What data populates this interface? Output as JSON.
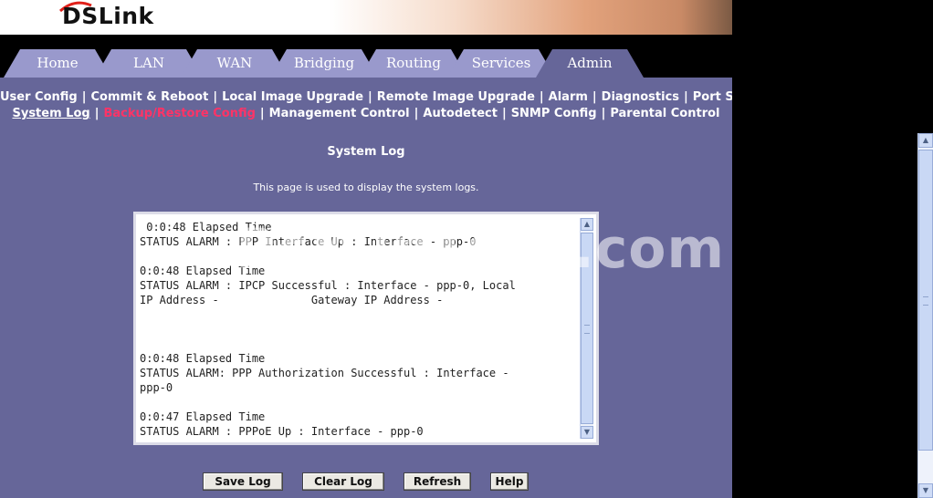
{
  "brand": {
    "logo_text": "DSLink"
  },
  "tabs": [
    {
      "label": "Home"
    },
    {
      "label": "LAN"
    },
    {
      "label": "WAN"
    },
    {
      "label": "Bridging"
    },
    {
      "label": "Routing"
    },
    {
      "label": "Services"
    },
    {
      "label": "Admin"
    }
  ],
  "active_tab": "Admin",
  "subnav": {
    "row1": [
      "User Config",
      "Commit & Reboot",
      "Local Image Upgrade",
      "Remote Image Upgrade",
      "Alarm",
      "Diagnostics",
      "Port Settings"
    ],
    "row2": [
      "System Log",
      "Backup/Restore Config",
      "Management Control",
      "Autodetect",
      "SNMP Config",
      "Parental Control"
    ],
    "separator": "|",
    "current": "System Log",
    "highlighted": "Backup/Restore Config"
  },
  "page": {
    "title": "System Log",
    "description": "This page is used to display the system logs."
  },
  "log": {
    "lines": [
      " 0:0:48 Elapsed Time",
      "STATUS ALARM : PPP Interface Up : Interface - ppp-0",
      "",
      "0:0:48 Elapsed Time",
      "STATUS ALARM : IPCP Successful : Interface - ppp-0, Local",
      "IP Address -              Gateway IP Address -",
      "",
      "",
      "",
      "0:0:48 Elapsed Time",
      "STATUS ALARM: PPP Authorization Successful : Interface -",
      "ppp-0",
      "",
      "0:0:47 Elapsed Time",
      "STATUS ALARM : PPPoE Up : Interface - ppp-0"
    ]
  },
  "buttons": {
    "save": "Save Log",
    "clear": "Clear Log",
    "refresh": "Refresh",
    "help": "Help"
  },
  "watermark": "PcWinTech.com",
  "colors": {
    "panel": "#666699",
    "tab": "#9999cc",
    "highlight_link": "#ff3366"
  }
}
